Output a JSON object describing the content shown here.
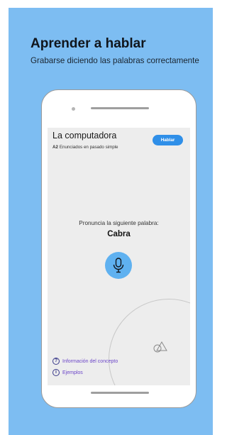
{
  "header": {
    "title": "Aprender a hablar",
    "subtitle": "Grabarse diciendo las palabras correctamente"
  },
  "lesson": {
    "title": "La computadora",
    "level": "A2",
    "topic": "Enunciados en pasado simple",
    "speak_button": "Hablar"
  },
  "exercise": {
    "prompt": "Pronuncia la siguiente palabra:",
    "word": "Cabra"
  },
  "links": {
    "concept": "Información del concepto",
    "examples": "Ejemplos"
  },
  "icons": {
    "mic": "microphone-icon",
    "shapes": "shapes-icon",
    "help": "question-circle-icon",
    "info": "info-circle-icon"
  },
  "colors": {
    "background": "#7dbdf2",
    "accent": "#2f8fe8",
    "mic": "#5fb1f0",
    "link": "#6b45c8"
  }
}
